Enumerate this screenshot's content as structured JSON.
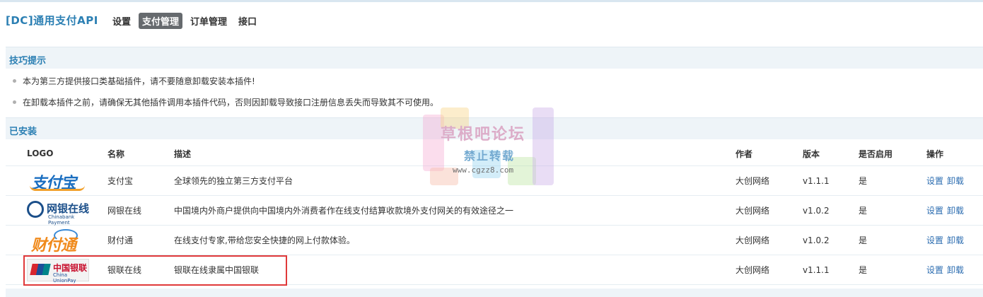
{
  "header": {
    "brand": "[DC]通用支付API",
    "nav": [
      {
        "label": "设置",
        "active": false
      },
      {
        "label": "支付管理",
        "active": true
      },
      {
        "label": "订单管理",
        "active": false
      },
      {
        "label": "接口",
        "active": false
      }
    ]
  },
  "tips_section": {
    "title": "技巧提示",
    "items": [
      "本为第三方提供接口类基础插件，请不要随意卸载安装本插件!",
      "在卸载本插件之前，请确保无其他插件调用本插件代码，否则因卸载导致接口注册信息丢失而导致其不可使用。"
    ]
  },
  "installed_section": {
    "title": "已安装",
    "columns": [
      "LOGO",
      "名称",
      "描述",
      "作者",
      "版本",
      "是否启用",
      "操作"
    ],
    "rows": [
      {
        "logo": "alipay-logo",
        "logo_text": "支付宝",
        "name": "支付宝",
        "desc": "全球领先的独立第三方支付平台",
        "author": "大创网络",
        "version": "v1.1.1",
        "enabled": "是",
        "op_settings": "设置",
        "op_uninstall": "卸载"
      },
      {
        "logo": "chinabank-logo",
        "logo_text": "网银在线",
        "logo_sub": "Chinabank Payment",
        "name": "网银在线",
        "desc": "中国境内外商户提供向中国境内外消费者作在线支付结算收款境外支付网关的有效途径之一",
        "author": "大创网络",
        "version": "v1.0.2",
        "enabled": "是",
        "op_settings": "设置",
        "op_uninstall": "卸载"
      },
      {
        "logo": "tenpay-logo",
        "logo_text": "财付通",
        "name": "财付通",
        "desc": "在线支付专家,带给您安全快捷的网上付款体验。",
        "author": "大创网络",
        "version": "v1.0.2",
        "enabled": "是",
        "op_settings": "设置",
        "op_uninstall": "卸载"
      },
      {
        "logo": "unionpay-logo",
        "logo_text": "中国银联",
        "logo_sub": "China UnionPay",
        "name": "银联在线",
        "desc": "银联在线隶属中国银联",
        "author": "大创网络",
        "version": "v1.1.1",
        "enabled": "是",
        "op_settings": "设置",
        "op_uninstall": "卸载"
      }
    ]
  },
  "watermark": {
    "title": "草根吧论坛",
    "subtitle": "禁止转载",
    "url": "www.cgzz8.com"
  },
  "colors": {
    "accent": "#2b7fb3",
    "nav_active_bg": "#666a6e",
    "section_bg": "#eef4f8",
    "link": "#2b6cb0",
    "highlight_border": "#e0393a"
  }
}
